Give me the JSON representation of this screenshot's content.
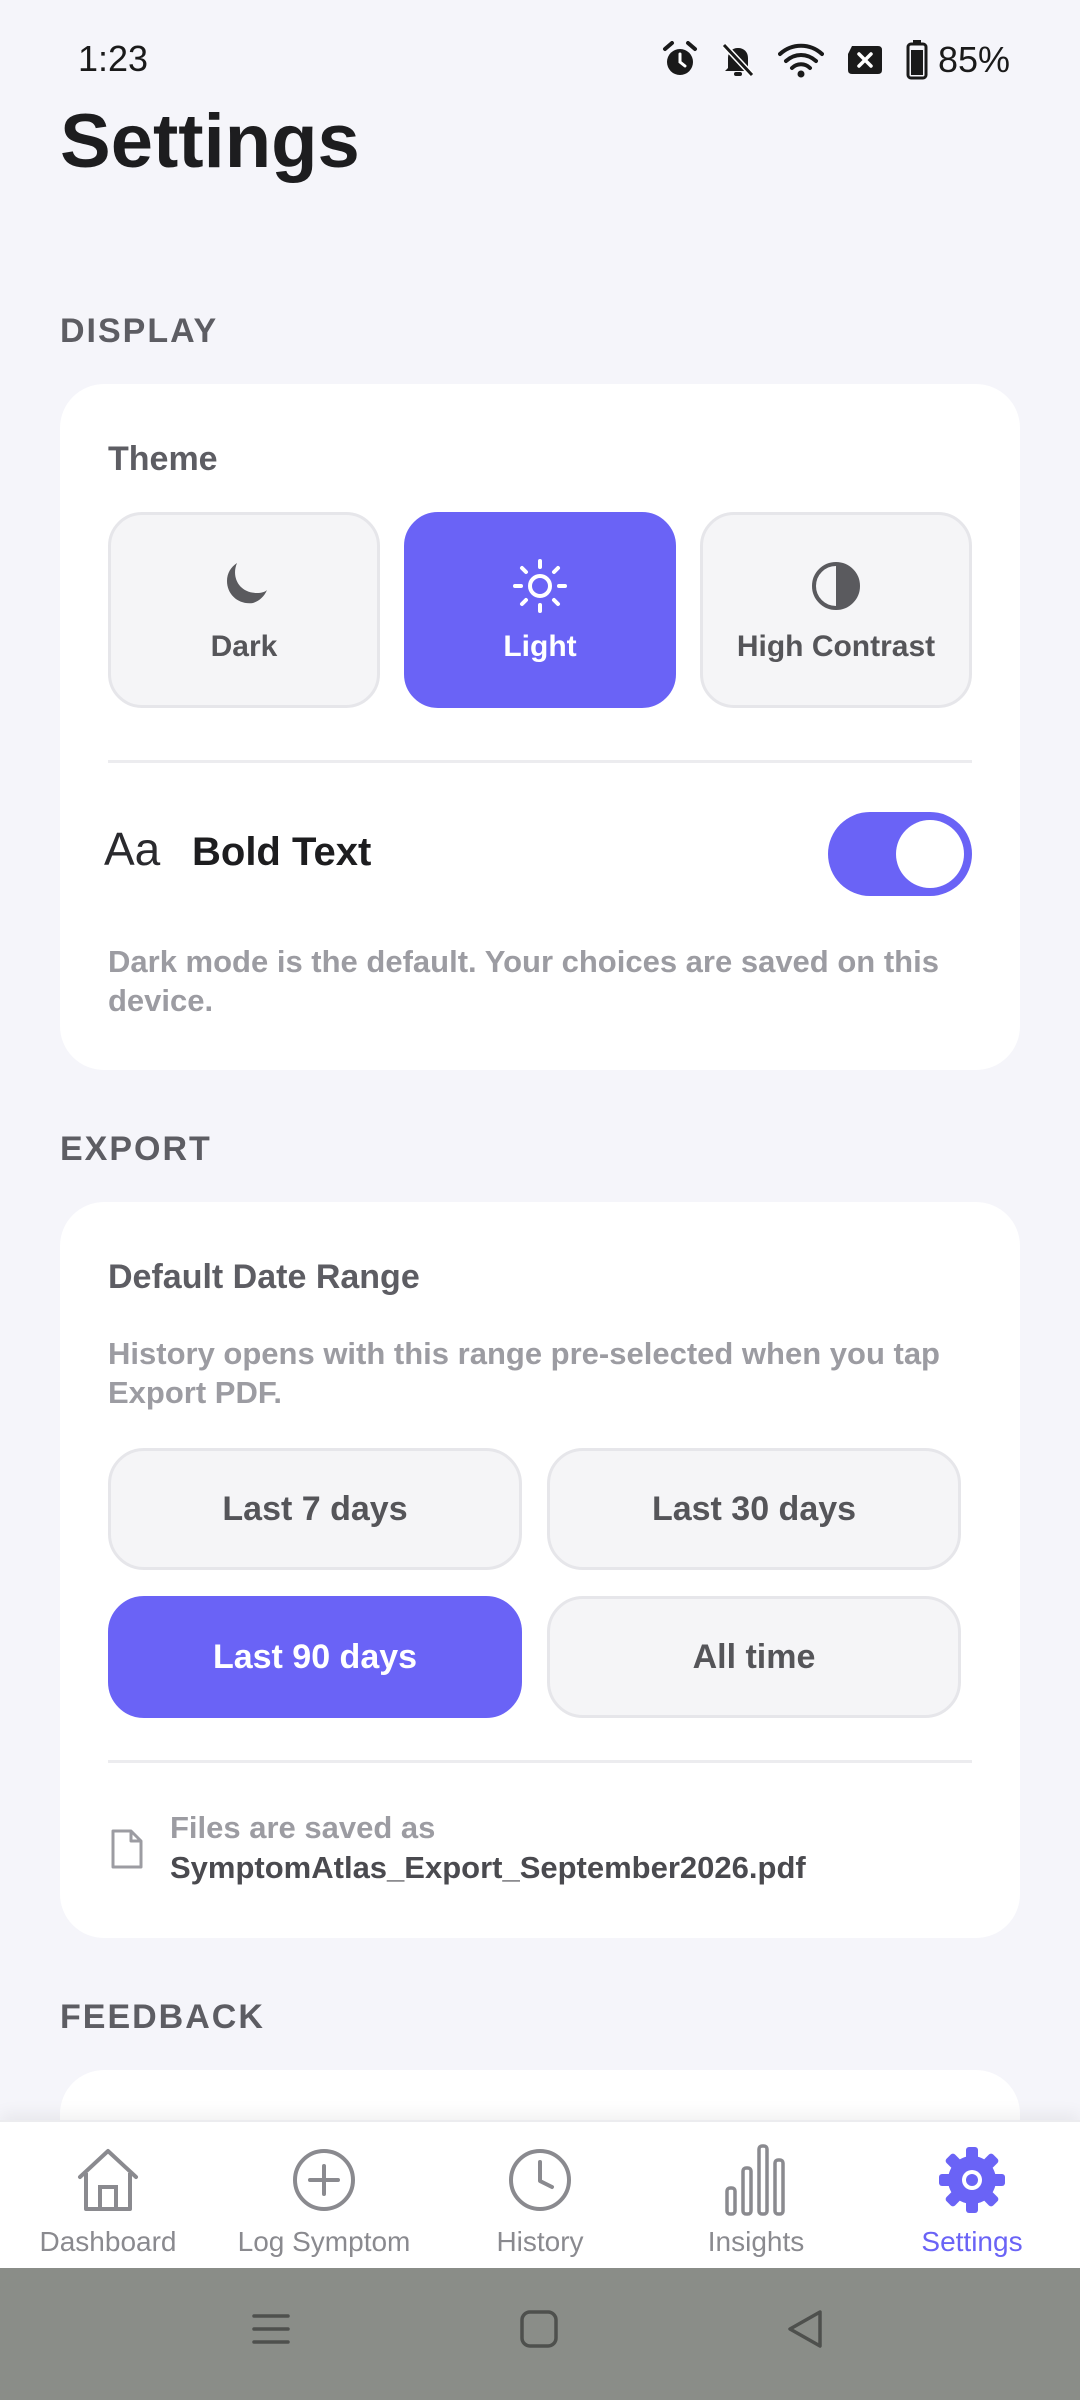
{
  "status_bar": {
    "time": "1:23",
    "battery": "85%",
    "icons": [
      "alarm-icon",
      "bell-off-icon",
      "wifi-icon",
      "sim-error-icon",
      "battery-icon"
    ]
  },
  "page": {
    "title": "Settings"
  },
  "display": {
    "header": "DISPLAY",
    "theme_label": "Theme",
    "themes": [
      {
        "label": "Dark",
        "icon": "moon-icon",
        "selected": false
      },
      {
        "label": "Light",
        "icon": "sun-icon",
        "selected": true
      },
      {
        "label": "High Contrast",
        "icon": "contrast-icon",
        "selected": false
      }
    ],
    "bold_text": {
      "icon_text": "Aa",
      "label": "Bold Text",
      "enabled": true
    },
    "helper": "Dark mode is the default. Your choices are saved on this device."
  },
  "export": {
    "header": "EXPORT",
    "range_label": "Default Date Range",
    "helper": "History opens with this range pre-selected when you tap Export PDF.",
    "ranges": [
      {
        "label": "Last 7 days",
        "selected": false
      },
      {
        "label": "Last 30 days",
        "selected": false
      },
      {
        "label": "Last 90 days",
        "selected": true
      },
      {
        "label": "All time",
        "selected": false
      }
    ],
    "file_label": "Files are saved as",
    "file_name": "SymptomAtlas_Export_September2026.pdf"
  },
  "feedback": {
    "header": "FEEDBACK"
  },
  "nav": {
    "items": [
      {
        "label": "Dashboard",
        "icon": "home-icon",
        "active": false
      },
      {
        "label": "Log Symptom",
        "icon": "plus-circle-icon",
        "active": false
      },
      {
        "label": "History",
        "icon": "clock-icon",
        "active": false
      },
      {
        "label": "Insights",
        "icon": "bar-chart-icon",
        "active": false
      },
      {
        "label": "Settings",
        "icon": "gear-icon",
        "active": true
      }
    ],
    "accent": "#6a63f6"
  }
}
